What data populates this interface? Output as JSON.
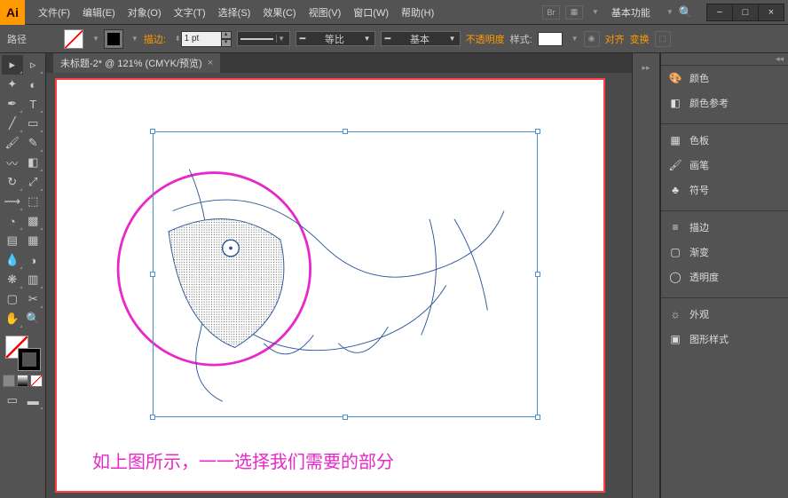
{
  "app": {
    "logo": "Ai"
  },
  "menu": {
    "file": "文件(F)",
    "edit": "编辑(E)",
    "object": "对象(O)",
    "type": "文字(T)",
    "select": "选择(S)",
    "effect": "效果(C)",
    "view": "视图(V)",
    "window": "窗口(W)",
    "help": "帮助(H)",
    "essentials": "基本功能"
  },
  "control": {
    "mode": "路径",
    "stroke_label": "描边:",
    "stroke_value": "1 pt",
    "profile_uniform": "等比",
    "profile_basic": "基本",
    "opacity_label": "不透明度",
    "style_label": "样式:",
    "align_label": "对齐",
    "transform_label": "变换"
  },
  "doc": {
    "tab_title": "未标题-2* @ 121% (CMYK/预览)"
  },
  "canvas": {
    "caption": "如上图所示，一一选择我们需要的部分"
  },
  "panels": {
    "color": "颜色",
    "color_guide": "颜色参考",
    "swatches": "色板",
    "brushes": "画笔",
    "symbols": "符号",
    "stroke": "描边",
    "gradient": "渐变",
    "transparency": "透明度",
    "appearance": "外观",
    "graphic_styles": "图形样式"
  },
  "win": {
    "min": "−",
    "max": "□",
    "close": "×"
  }
}
